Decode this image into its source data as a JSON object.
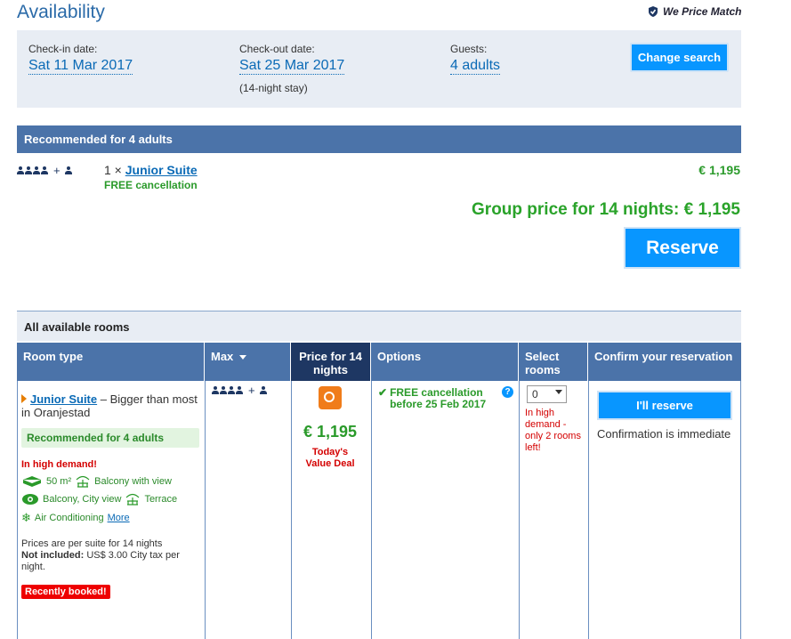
{
  "header": {
    "title": "Availability",
    "price_match": "We Price Match"
  },
  "search": {
    "checkin_label": "Check-in date:",
    "checkin_value": "Sat 11 Mar 2017",
    "checkout_label": "Check-out date:",
    "checkout_value": "Sat 25 Mar 2017",
    "stay_note": "(14-night stay)",
    "guests_label": "Guests:",
    "guests_value": "4 adults",
    "change_button": "Change search"
  },
  "recommended": {
    "bar_title": "Recommended for 4 adults",
    "plus": "+",
    "qty": "1 ×",
    "room_link": "Junior Suite",
    "free_cancellation": "FREE cancellation",
    "price": "€ 1,195",
    "group_price": "Group price for 14 nights: € 1,195",
    "reserve_button": "Reserve"
  },
  "table": {
    "bar_title": "All available rooms",
    "headers": {
      "room_type": "Room type",
      "max": "Max",
      "price_line1": "Price for 14",
      "price_line2": "nights",
      "options": "Options",
      "select_line1": "Select",
      "select_line2": "rooms",
      "confirm": "Confirm your reservation"
    },
    "row": {
      "room_link": "Junior Suite",
      "room_desc": " – Bigger than most in Oranjestad",
      "rec_badge": "Recommended for 4 adults",
      "demand": "In high demand!",
      "feat1_size": "50 m²",
      "feat1_b": "Balcony with view",
      "feat2_a": "Balcony, City view",
      "feat2_b": "Terrace",
      "feat3_a": "Air Conditioning",
      "more": "More",
      "policy_line1": "Prices are per suite for 14 nights",
      "policy_not_incl": "Not included:",
      "policy_tax": " US$ 3.00 City tax per night.",
      "recently_booked": "Recently booked!",
      "plus": "+",
      "price": "€ 1,195",
      "deal_line1": "Today's",
      "deal_line2": "Value Deal",
      "option": "FREE cancellation before 25 Feb 2017",
      "help": "?",
      "select_value": "0",
      "select_note": "In high demand - only 2 rooms left!",
      "ill_reserve": "I'll reserve",
      "confirm_note": "Confirmation is immediate"
    }
  },
  "colors": {
    "primary_blue": "#0896ff",
    "header_blue": "#4b73a9",
    "dark_navy": "#1e3763",
    "green": "#2a9a2a",
    "red": "#d40000",
    "orange": "#f07c1a"
  }
}
